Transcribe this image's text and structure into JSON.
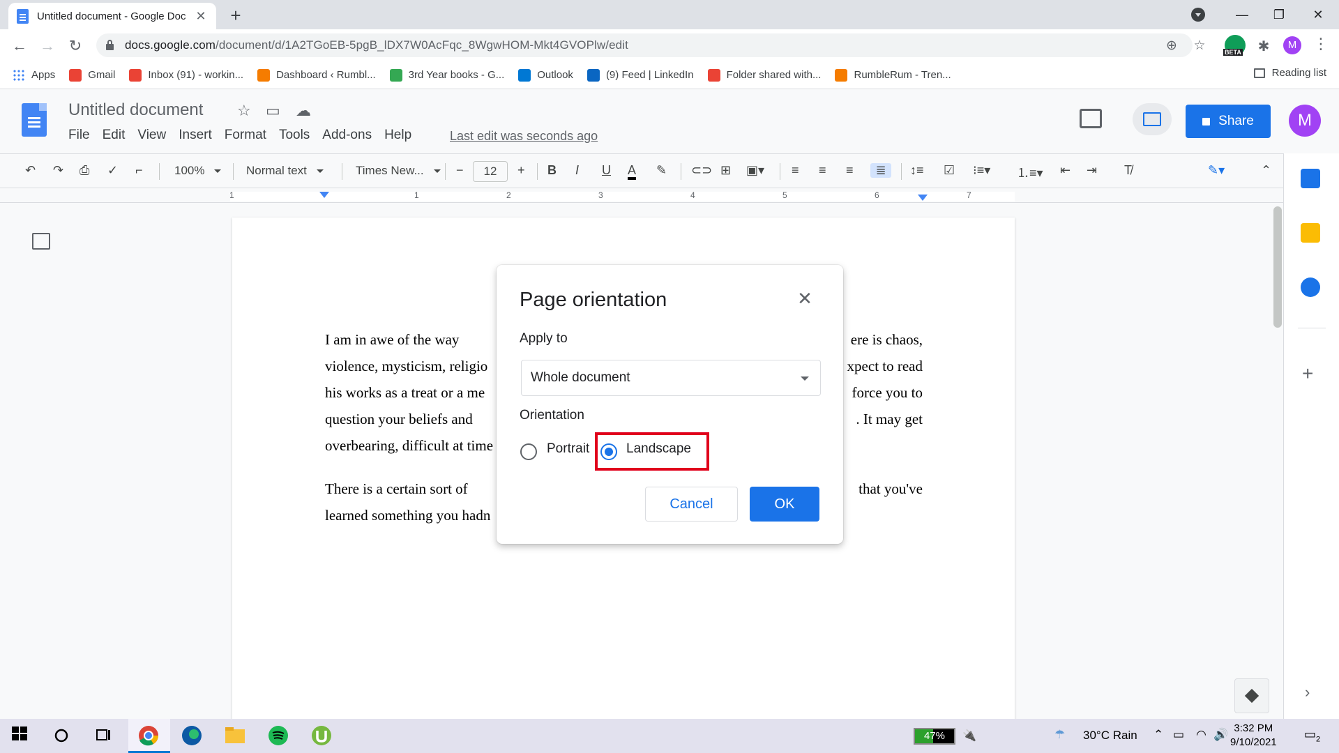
{
  "browser": {
    "tab_title": "Untitled document - Google Doc",
    "url_host": "docs.google.com",
    "url_path": "/document/d/1A2TGoEB-5pgB_lDX7W0AcFqc_8WgwHOM-Mkt4GVOPlw/edit",
    "profile_initial": "M",
    "beta_label": "BETA",
    "bookmarks": [
      {
        "label": "Apps",
        "icon": "apps-grid-icon",
        "color": "#4285f4"
      },
      {
        "label": "Gmail",
        "icon": "gmail-icon",
        "color": "#ea4335"
      },
      {
        "label": "Inbox (91) - workin...",
        "icon": "gmail-icon",
        "color": "#ea4335"
      },
      {
        "label": "Dashboard ‹ Rumbl...",
        "icon": "rumble-icon",
        "color": "#f57c00"
      },
      {
        "label": "3rd Year books - G...",
        "icon": "google-drive-icon",
        "color": "#34a853"
      },
      {
        "label": "Outlook",
        "icon": "outlook-icon",
        "color": "#0078d4"
      },
      {
        "label": "(9) Feed | LinkedIn",
        "icon": "linkedin-icon",
        "color": "#0a66c2"
      },
      {
        "label": "Folder shared with...",
        "icon": "gmail-icon",
        "color": "#ea4335"
      },
      {
        "label": "RumbleRum - Tren...",
        "icon": "rumble-icon",
        "color": "#f57c00"
      }
    ],
    "reading_list": "Reading list"
  },
  "docs": {
    "title": "Untitled document",
    "menus": [
      "File",
      "Edit",
      "View",
      "Insert",
      "Format",
      "Tools",
      "Add-ons",
      "Help"
    ],
    "last_edit": "Last edit was seconds ago",
    "share_label": "Share",
    "user_initial": "M",
    "toolbar": {
      "zoom": "100%",
      "style": "Normal text",
      "font": "Times New...",
      "font_size": "12"
    },
    "ruler_numbers": [
      "1",
      "1",
      "2",
      "3",
      "4",
      "5",
      "6",
      "7"
    ],
    "paragraphs": [
      {
        "lines": [
          {
            "left": "I am in awe of the way",
            "right": "ere is chaos,"
          },
          {
            "left": "violence, mysticism, religio",
            "right": "xpect to read"
          },
          {
            "left": "his works as a treat or a me",
            "right": "force you to"
          },
          {
            "left": "question your beliefs and",
            "right": ". It may get"
          },
          {
            "left": "overbearing, difficult at time",
            "right": ""
          }
        ]
      },
      {
        "lines": [
          {
            "left": "There is a certain sort of",
            "right": "that you've"
          },
          {
            "left": "learned something you hadn",
            "right": ""
          }
        ]
      }
    ]
  },
  "dialog": {
    "title": "Page orientation",
    "apply_to_label": "Apply to",
    "apply_to_value": "Whole document",
    "orientation_label": "Orientation",
    "portrait_label": "Portrait",
    "landscape_label": "Landscape",
    "selected": "Landscape",
    "cancel_label": "Cancel",
    "ok_label": "OK"
  },
  "taskbar": {
    "battery": "47%",
    "battery_level": 0.47,
    "weather": "30°C  Rain",
    "time": "3:32 PM",
    "date": "9/10/2021",
    "notifications": "2"
  },
  "colors": {
    "accent": "#1a73e8",
    "highlight": "#e0001b"
  }
}
